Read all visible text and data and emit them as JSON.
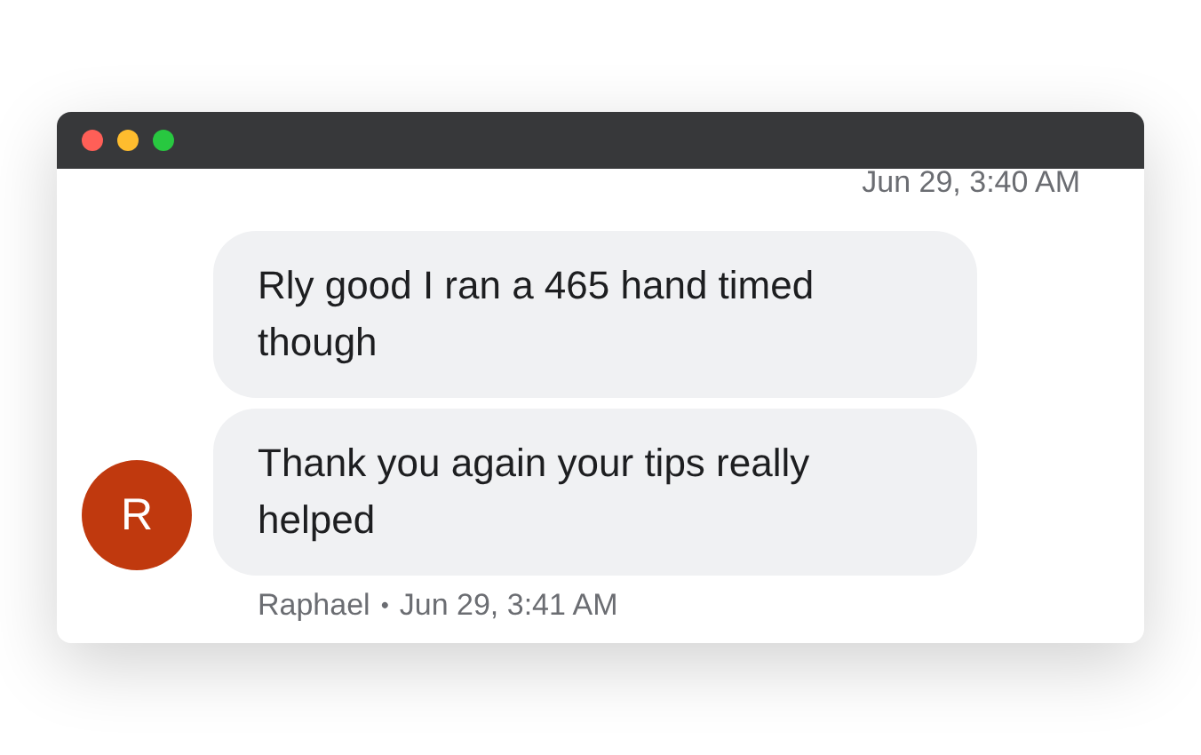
{
  "window": {
    "controls": [
      {
        "color": "#ff5f57"
      },
      {
        "color": "#febc2e"
      },
      {
        "color": "#28c840"
      }
    ]
  },
  "top_timestamp": "Jun 29, 3:40 AM",
  "messages": [
    {
      "text": "Rly good I ran a 465 hand timed though"
    },
    {
      "text": "Thank you again your tips really helped"
    }
  ],
  "avatar": {
    "initial": "R",
    "color": "#c0390e"
  },
  "footer": {
    "sender": "Raphael",
    "separator": "•",
    "time": "Jun 29, 3:41 AM"
  }
}
